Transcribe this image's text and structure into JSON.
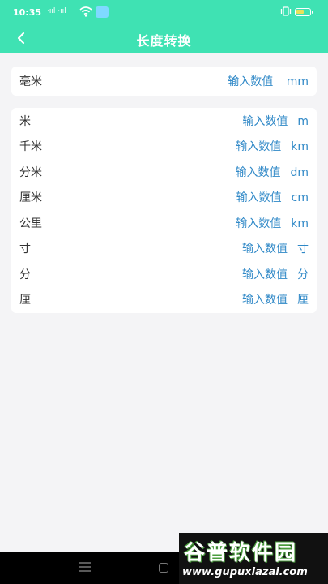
{
  "status": {
    "time": "10:35",
    "signal": "·ııl ·ııl"
  },
  "header": {
    "title": "长度转换"
  },
  "top_card": {
    "label": "毫米",
    "placeholder": "输入数值",
    "unit": "mm"
  },
  "units": [
    {
      "label": "米",
      "placeholder": "输入数值",
      "unit": "m"
    },
    {
      "label": "千米",
      "placeholder": "输入数值",
      "unit": "km"
    },
    {
      "label": "分米",
      "placeholder": "输入数值",
      "unit": "dm"
    },
    {
      "label": "厘米",
      "placeholder": "输入数值",
      "unit": "cm"
    },
    {
      "label": "公里",
      "placeholder": "输入数值",
      "unit": "km"
    },
    {
      "label": "寸",
      "placeholder": "输入数值",
      "unit": "寸"
    },
    {
      "label": "分",
      "placeholder": "输入数值",
      "unit": "分"
    },
    {
      "label": "厘",
      "placeholder": "输入数值",
      "unit": "厘"
    }
  ],
  "watermark": {
    "brand": "谷普软件园",
    "url": "www.gupuxiazai.com"
  },
  "colors": {
    "accent": "#3fe2b3",
    "value_text": "#2f88c7",
    "background": "#f4f4f6"
  },
  "icons": {
    "back": "chevron-left-icon",
    "wifi": "wifi-icon",
    "battery": "battery-icon"
  },
  "battery_level": 0.6
}
